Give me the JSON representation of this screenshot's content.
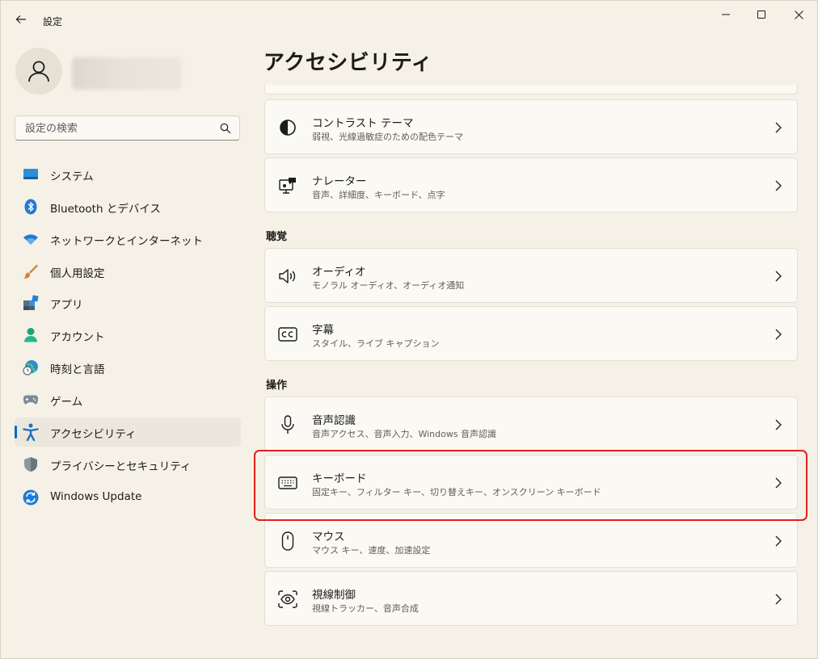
{
  "window": {
    "title": "設定"
  },
  "sidebar": {
    "search_placeholder": "設定の検索",
    "items": [
      {
        "label": "システム",
        "icon": "monitor-icon"
      },
      {
        "label": "Bluetooth とデバイス",
        "icon": "bluetooth-icon"
      },
      {
        "label": "ネットワークとインターネット",
        "icon": "wifi-icon"
      },
      {
        "label": "個人用設定",
        "icon": "brush-icon"
      },
      {
        "label": "アプリ",
        "icon": "apps-icon"
      },
      {
        "label": "アカウント",
        "icon": "account-icon"
      },
      {
        "label": "時刻と言語",
        "icon": "globe-clock-icon"
      },
      {
        "label": "ゲーム",
        "icon": "gamepad-icon"
      },
      {
        "label": "アクセシビリティ",
        "icon": "accessibility-icon",
        "selected": true
      },
      {
        "label": "プライバシーとセキュリティ",
        "icon": "shield-icon"
      },
      {
        "label": "Windows Update",
        "icon": "update-icon"
      }
    ]
  },
  "main": {
    "title": "アクセシビリティ",
    "sections": [
      {
        "header": "聴覚"
      },
      {
        "header": "操作"
      }
    ],
    "cards": [
      {
        "title": "コントラスト テーマ",
        "desc": "弱視、光線過敏症のための配色テーマ",
        "icon": "contrast-icon"
      },
      {
        "title": "ナレーター",
        "desc": "音声、詳細度、キーボード、点字",
        "icon": "narrator-icon"
      },
      {
        "title": "オーディオ",
        "desc": "モノラル オーディオ、オーディオ通知",
        "icon": "speaker-icon"
      },
      {
        "title": "字幕",
        "desc": "スタイル、ライブ キャプション",
        "icon": "closed-caption-icon"
      },
      {
        "title": "音声認識",
        "desc": "音声アクセス、音声入力、Windows 音声認識",
        "icon": "microphone-icon"
      },
      {
        "title": "キーボード",
        "desc": "固定キー、フィルター キー、切り替えキー、オンスクリーン キーボード",
        "icon": "keyboard-icon",
        "highlighted": true
      },
      {
        "title": "マウス",
        "desc": "マウス キー、速度、加速設定",
        "icon": "mouse-icon"
      },
      {
        "title": "視線制御",
        "desc": "視線トラッカー、音声合成",
        "icon": "eye-control-icon"
      }
    ]
  },
  "colors": {
    "accent": "#0067c0",
    "highlight": "#e02020",
    "background": "#f5f1e6",
    "card": "#fbf9f4"
  }
}
